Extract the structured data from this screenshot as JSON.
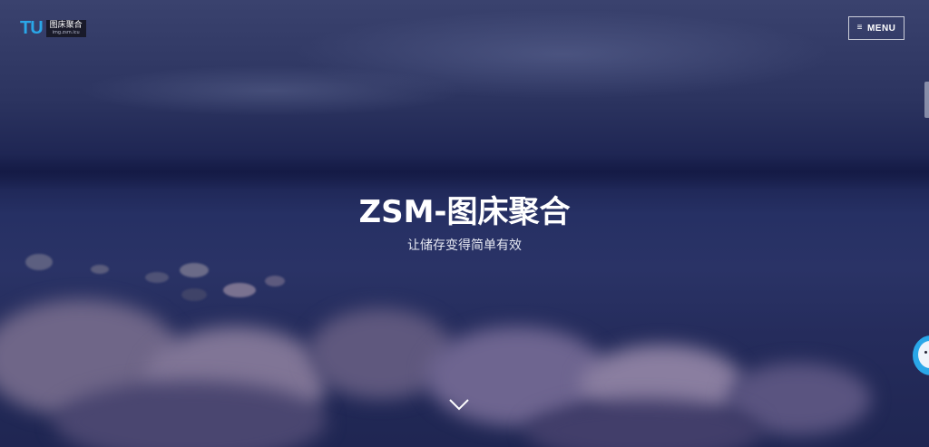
{
  "header": {
    "logo_mark": "TU",
    "logo_name": "图床聚合",
    "logo_sub": "img.zsm.icu",
    "menu_label": "MENU",
    "menu_icon": "hamburger-icon"
  },
  "hero": {
    "title": "ZSM-图床聚合",
    "subtitle": "让储存变得简单有效",
    "scroll_icon": "chevron-down-icon"
  },
  "widgets": {
    "side_tab_icon": "side-tab",
    "mascot_icon": "mascot-avatar-icon"
  },
  "colors": {
    "accent": "#2aa7e8",
    "background": "#1c2350",
    "text": "#ffffff"
  }
}
